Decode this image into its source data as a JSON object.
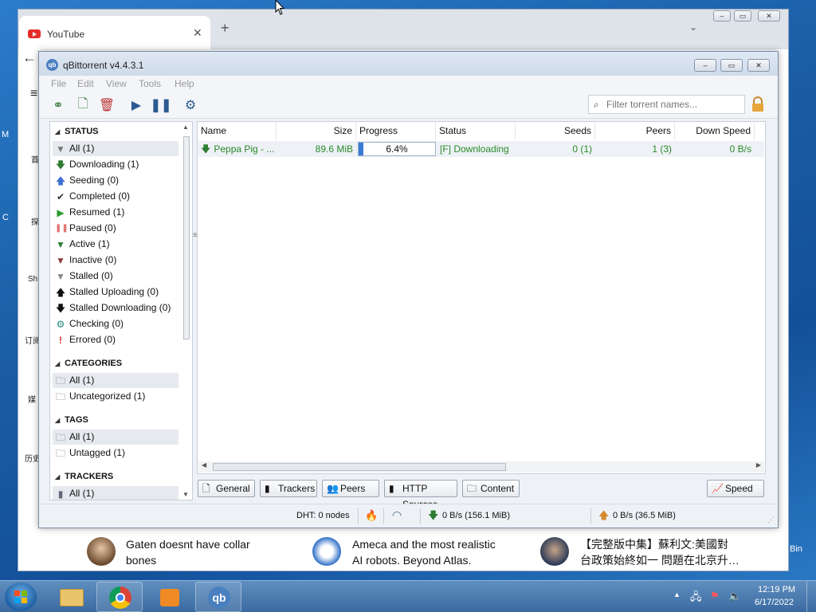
{
  "chrome": {
    "tab_title": "YouTube",
    "side_labels": [
      "首",
      "探",
      "Sh",
      "订阅",
      "媒",
      "历史"
    ],
    "side_left_labels": [
      "M",
      "C"
    ],
    "right_label": "Bin"
  },
  "feed": [
    {
      "line1": "Gaten doesnt have collar",
      "line2": "bones"
    },
    {
      "line1": "Ameca and the most realistic",
      "line2": "AI robots. Beyond Atlas."
    },
    {
      "line1": "【完整版中集】蘇利文:美國對",
      "line2": "台政策始終如一 問題在北京升…"
    }
  ],
  "qb": {
    "title": "qBittorrent v4.4.3.1",
    "menu": [
      "File",
      "Edit",
      "View",
      "Tools",
      "Help"
    ],
    "search_placeholder": "Filter torrent names...",
    "sidebar": {
      "status_header": "STATUS",
      "status_items": [
        {
          "label": "All (1)",
          "icon": "filter-icon",
          "color": "#777777"
        },
        {
          "label": "Downloading (1)",
          "icon": "download-arrow-icon",
          "color": "#2e7d32"
        },
        {
          "label": "Seeding (0)",
          "icon": "upload-arrow-icon",
          "color": "#3b6fd1"
        },
        {
          "label": "Completed (0)",
          "icon": "checkmark-icon",
          "color": "#333333"
        },
        {
          "label": "Resumed (1)",
          "icon": "play-icon",
          "color": "#2e9a2e"
        },
        {
          "label": "Paused (0)",
          "icon": "pause-icon",
          "color": "#e57373"
        },
        {
          "label": "Active (1)",
          "icon": "filter-icon",
          "color": "#2e7d32"
        },
        {
          "label": "Inactive (0)",
          "icon": "filter-icon",
          "color": "#8b3a3a"
        },
        {
          "label": "Stalled (0)",
          "icon": "filter-icon",
          "color": "#888888"
        },
        {
          "label": "Stalled Uploading (0)",
          "icon": "upload-arrow-icon",
          "color": "#111111"
        },
        {
          "label": "Stalled Downloading (0)",
          "icon": "download-arrow-icon",
          "color": "#111111"
        },
        {
          "label": "Checking (0)",
          "icon": "gear-icon",
          "color": "#1c8a7a"
        },
        {
          "label": "Errored (0)",
          "icon": "exclamation-icon",
          "color": "#d32f2f"
        }
      ],
      "categories_header": "CATEGORIES",
      "category_items": [
        "All (1)",
        "Uncategorized (1)"
      ],
      "tags_header": "TAGS",
      "tag_items": [
        "All (1)",
        "Untagged (1)"
      ],
      "trackers_header": "TRACKERS",
      "tracker_items": [
        "All (1)"
      ]
    },
    "table": {
      "columns": [
        "Name",
        "Size",
        "Progress",
        "Status",
        "Seeds",
        "Peers",
        "Down Speed"
      ],
      "rows": [
        {
          "name": "Peppa Pig - ...",
          "size": "89.6 MiB",
          "progress_text": "6.4%",
          "progress": 0.064,
          "status": "[F] Downloading",
          "seeds": "0 (1)",
          "peers": "1 (3)",
          "down_speed": "0 B/s"
        }
      ]
    },
    "bottom_tabs": [
      "General",
      "Trackers",
      "Peers",
      "HTTP Sources",
      "Content"
    ],
    "speed_button": "Speed",
    "status": {
      "dht": "DHT: 0 nodes",
      "down": "0 B/s (156.1 MiB)",
      "up": "0 B/s (36.5 MiB)"
    }
  },
  "taskbar": {
    "time": "12:19 PM",
    "date": "6/17/2022"
  }
}
